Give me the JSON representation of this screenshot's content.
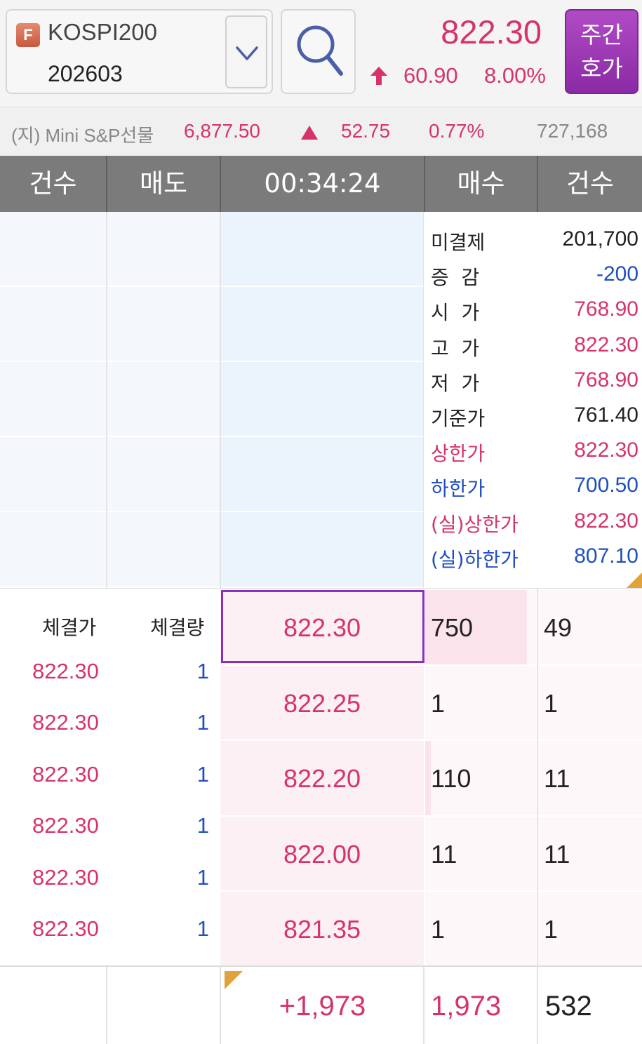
{
  "header": {
    "badge": "F",
    "symbol_name": "KOSPI200",
    "symbol_code": "202603",
    "price": "822.30",
    "change": "60.90",
    "change_rate": "8.00%",
    "weekly_btn_line1": "주간",
    "weekly_btn_line2": "호가",
    "accent_up": "#d6336c",
    "accent_purple": "#8a2aa5"
  },
  "ticker": {
    "name": "(지) Mini S&P선물",
    "price": "6,877.50",
    "change": "52.75",
    "rate": "0.77%",
    "volume": "727,168"
  },
  "columns": {
    "ask_count": "건수",
    "ask": "매도",
    "time": "00:34:24",
    "bid": "매수",
    "bid_count": "건수"
  },
  "info": [
    {
      "label": "미결제",
      "value": "201,700",
      "label_color": "#222222",
      "value_color": "#222222"
    },
    {
      "label": "증  감",
      "value": "-200",
      "label_color": "#222222",
      "value_color": "#1f4fbf"
    },
    {
      "label": "시  가",
      "value": "768.90",
      "label_color": "#222222",
      "value_color": "#d6336c"
    },
    {
      "label": "고  가",
      "value": "822.30",
      "label_color": "#222222",
      "value_color": "#d6336c"
    },
    {
      "label": "저  가",
      "value": "768.90",
      "label_color": "#222222",
      "value_color": "#d6336c"
    },
    {
      "label": "기준가",
      "value": "761.40",
      "label_color": "#222222",
      "value_color": "#222222"
    },
    {
      "label": "상한가",
      "value": "822.30",
      "label_color": "#d6336c",
      "value_color": "#d6336c"
    },
    {
      "label": "하한가",
      "value": "700.50",
      "label_color": "#1f4fbf",
      "value_color": "#1f4fbf"
    },
    {
      "label": "(실)상한가",
      "value": "822.30",
      "label_color": "#d6336c",
      "value_color": "#d6336c"
    },
    {
      "label": "(실)하한가",
      "value": "807.10",
      "label_color": "#1f4fbf",
      "value_color": "#1f4fbf"
    }
  ],
  "trades": {
    "price_header": "체결가",
    "qty_header": "체결량",
    "rows": [
      {
        "price": "822.30",
        "qty": "1"
      },
      {
        "price": "822.30",
        "qty": "1"
      },
      {
        "price": "822.30",
        "qty": "1"
      },
      {
        "price": "822.30",
        "qty": "1"
      },
      {
        "price": "822.30",
        "qty": "1"
      },
      {
        "price": "822.30",
        "qty": "1"
      }
    ]
  },
  "bids": [
    {
      "price": "822.30",
      "qty": "750",
      "count": "49",
      "qty_fraction": 0.92
    },
    {
      "price": "822.25",
      "qty": "1",
      "count": "1",
      "qty_fraction": 0
    },
    {
      "price": "822.20",
      "qty": "110",
      "count": "11",
      "qty_fraction": 0.05
    },
    {
      "price": "822.00",
      "qty": "11",
      "count": "11",
      "qty_fraction": 0
    },
    {
      "price": "821.35",
      "qty": "1",
      "count": "1",
      "qty_fraction": 0
    }
  ],
  "footer": {
    "net": "+1,973",
    "bid_total": "1,973",
    "bid_count_total": "532"
  }
}
